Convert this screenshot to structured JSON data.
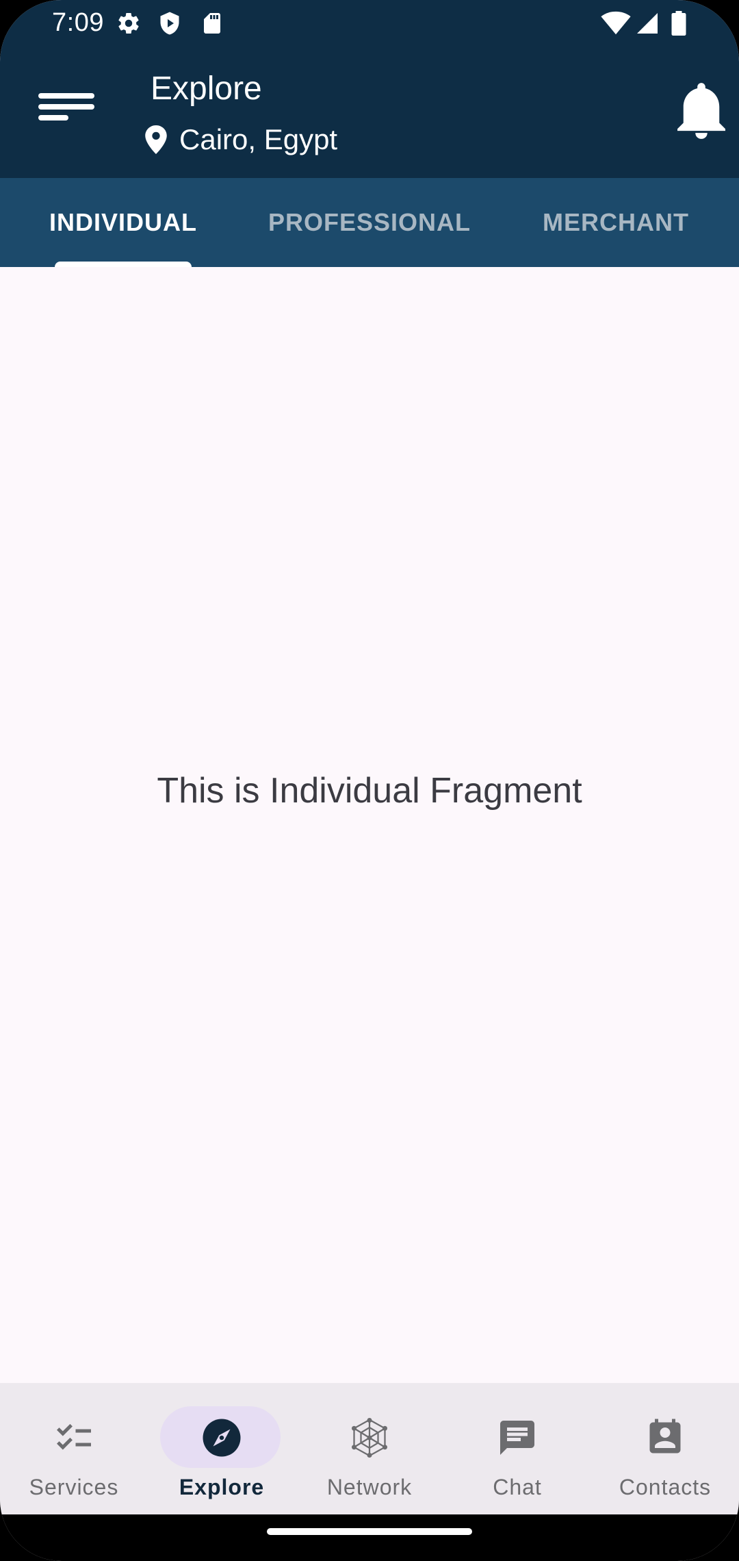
{
  "status_bar": {
    "time": "7:09",
    "icons": [
      "settings-icon",
      "play-protect-icon",
      "sd-card-icon",
      "wifi-icon",
      "signal-icon",
      "battery-icon"
    ]
  },
  "app_bar": {
    "title": "Explore",
    "location": "Cairo, Egypt",
    "menu_icon": "menu-icon",
    "notification_icon": "bell-icon",
    "background_color": "#0e2d45"
  },
  "tabs": {
    "items": [
      {
        "label": "INDIVIDUAL",
        "active": true
      },
      {
        "label": "PROFESSIONAL",
        "active": false
      },
      {
        "label": "MERCHANT",
        "active": false
      }
    ],
    "background_color": "#1c4a6b"
  },
  "content": {
    "message": "This is Individual Fragment"
  },
  "bottom_nav": {
    "items": [
      {
        "label": "Services",
        "icon": "checklist-icon",
        "active": false
      },
      {
        "label": "Explore",
        "icon": "compass-icon",
        "active": true
      },
      {
        "label": "Network",
        "icon": "network-icon",
        "active": false
      },
      {
        "label": "Chat",
        "icon": "chat-icon",
        "active": false
      },
      {
        "label": "Contacts",
        "icon": "contacts-icon",
        "active": false
      }
    ]
  }
}
